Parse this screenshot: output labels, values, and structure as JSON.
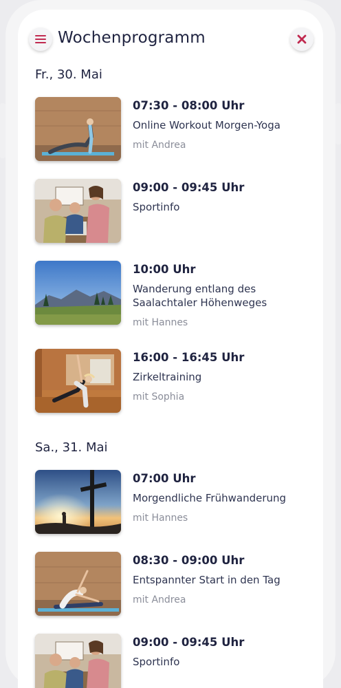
{
  "header": {
    "title": "Wochenprogramm",
    "menu_icon": "hamburger-menu-icon",
    "close_icon": "close-icon"
  },
  "colors": {
    "accent": "#c0294f",
    "text_dark": "#1f2340",
    "text_muted": "#8a8d99",
    "background": "#ffffff"
  },
  "days": [
    {
      "label": "Fr., 30. Mai",
      "events": [
        {
          "time": "07:30 - 08:00 Uhr",
          "title": "Online Workout Morgen-Yoga",
          "host": "mit Andrea",
          "image": "yoga-upward-dog"
        },
        {
          "time": "09:00 - 09:45 Uhr",
          "title": "Sportinfo",
          "host": "",
          "image": "group-meeting"
        },
        {
          "time": "10:00 Uhr",
          "title": "Wanderung entlang des Saalachtaler Höhenweges",
          "host": "mit Hannes",
          "image": "mountain-meadow"
        },
        {
          "time": "16:00 - 16:45 Uhr",
          "title": "Zirkeltraining",
          "host": "mit Sophia",
          "image": "side-plank-gym"
        }
      ]
    },
    {
      "label": "Sa., 31. Mai",
      "events": [
        {
          "time": "07:00 Uhr",
          "title": "Morgendliche Frühwanderung",
          "host": "mit Hannes",
          "image": "summit-cross-sunrise"
        },
        {
          "time": "08:30 - 09:00 Uhr",
          "title": "Entspannter Start in den Tag",
          "host": "mit Andrea",
          "image": "yoga-seated-stretch"
        },
        {
          "time": "09:00 - 09:45 Uhr",
          "title": "Sportinfo",
          "host": "",
          "image": "group-meeting"
        }
      ]
    }
  ]
}
